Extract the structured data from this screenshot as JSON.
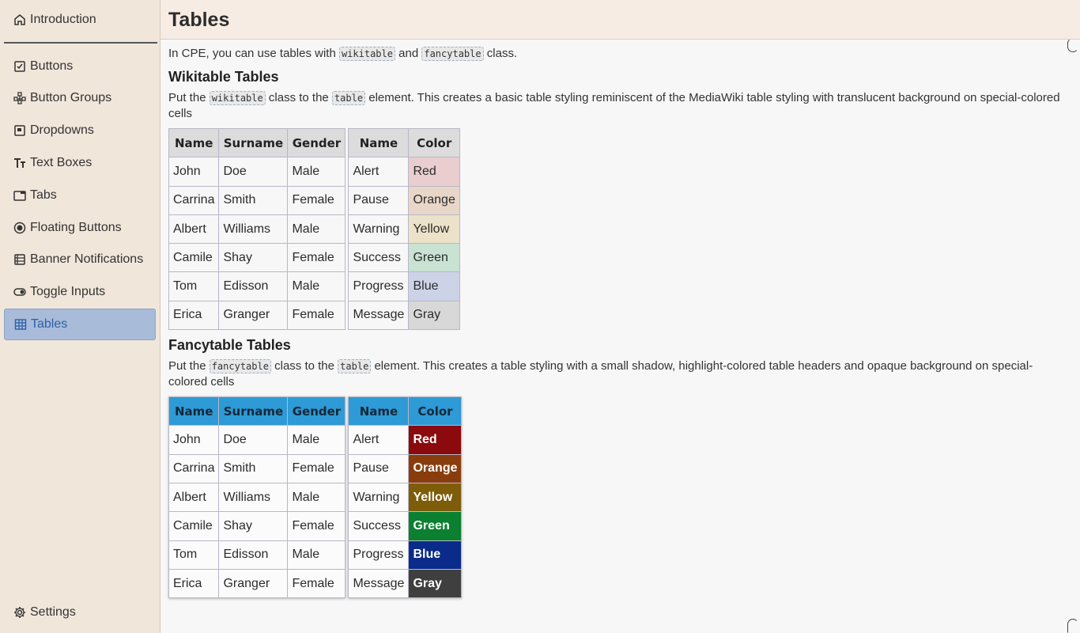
{
  "sidebar": {
    "items": [
      {
        "label": "Introduction",
        "icon": "home-icon"
      },
      {
        "label": "Buttons",
        "icon": "checkbox-icon"
      },
      {
        "label": "Button Groups",
        "icon": "hierarchy-icon"
      },
      {
        "label": "Dropdowns",
        "icon": "dropdown-icon"
      },
      {
        "label": "Text Boxes",
        "icon": "text-size-icon"
      },
      {
        "label": "Tabs",
        "icon": "tab-icon"
      },
      {
        "label": "Floating Buttons",
        "icon": "radio-icon"
      },
      {
        "label": "Banner Notifications",
        "icon": "list-icon"
      },
      {
        "label": "Toggle Inputs",
        "icon": "toggle-icon"
      },
      {
        "label": "Tables",
        "icon": "table-icon"
      }
    ],
    "settings": {
      "label": "Settings",
      "icon": "gear-icon"
    }
  },
  "header": {
    "title": "Tables"
  },
  "intro": {
    "t1": "In CPE, you can use tables with ",
    "c1": "wikitable",
    "t2": " and ",
    "c2": "fancytable",
    "t3": " class."
  },
  "wiki": {
    "heading": "Wikitable Tables",
    "p1": "Put the ",
    "c1": "wikitable",
    "p2": " class to the ",
    "c2": "table",
    "p3": " element. This creates a basic table styling reminiscent of the MediaWiki table styling with translucent background on special-colored cells"
  },
  "fancy": {
    "heading": "Fancytable Tables",
    "p1": "Put the ",
    "c1": "fancytable",
    "p2": " class to the ",
    "c2": "table",
    "p3": " element. This creates a table styling with a small shadow, highlight-colored table headers and opaque background on special-colored cells"
  },
  "people_table": {
    "headers": [
      "Name",
      "Surname",
      "Gender"
    ],
    "rows": [
      [
        "John",
        "Doe",
        "Male"
      ],
      [
        "Carrina",
        "Smith",
        "Female"
      ],
      [
        "Albert",
        "Williams",
        "Male"
      ],
      [
        "Camile",
        "Shay",
        "Female"
      ],
      [
        "Tom",
        "Edisson",
        "Male"
      ],
      [
        "Erica",
        "Granger",
        "Female"
      ]
    ]
  },
  "color_table": {
    "headers": [
      "Name",
      "Color"
    ],
    "rows": [
      {
        "name": "Alert",
        "color": "Red",
        "wiki_bg": "#e9cdcf",
        "fancy_bg": "#8b0a0e"
      },
      {
        "name": "Pause",
        "color": "Orange",
        "wiki_bg": "#e8d7c8",
        "fancy_bg": "#8a3d0c"
      },
      {
        "name": "Warning",
        "color": "Yellow",
        "wiki_bg": "#ebe2c9",
        "fancy_bg": "#7d5c0a"
      },
      {
        "name": "Success",
        "color": "Green",
        "wiki_bg": "#c9e2d3",
        "fancy_bg": "#0a8030"
      },
      {
        "name": "Progress",
        "color": "Blue",
        "wiki_bg": "#cdd3e6",
        "fancy_bg": "#0a2b8a"
      },
      {
        "name": "Message",
        "color": "Gray",
        "wiki_bg": "#d8d8d8",
        "fancy_bg": "#3f3f3f"
      }
    ]
  }
}
